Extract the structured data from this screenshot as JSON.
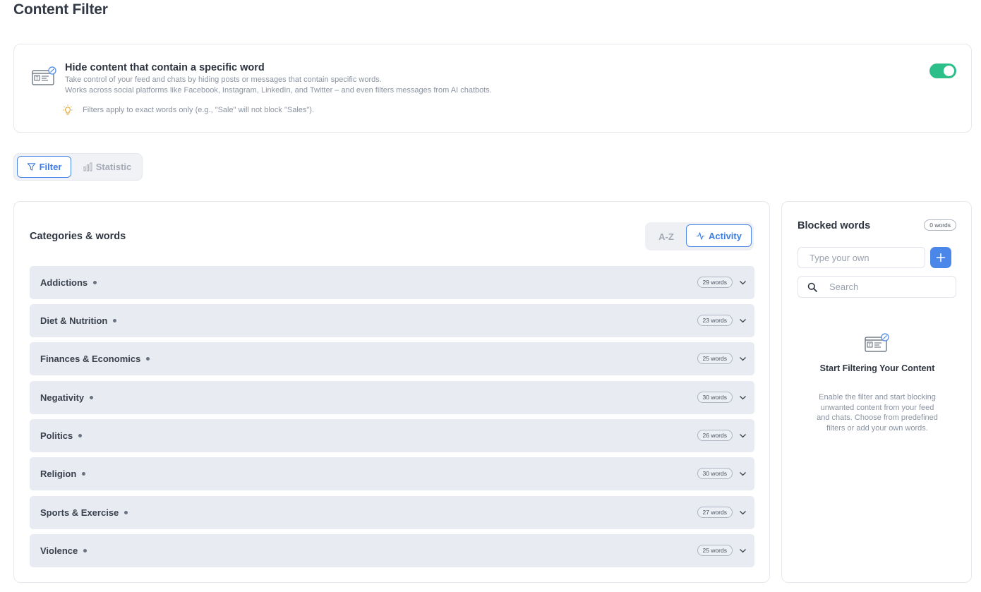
{
  "page": {
    "title": "Content Filter"
  },
  "info": {
    "title": "Hide content that contain a specific word",
    "desc_line1": "Take control of your feed and chats by hiding posts or messages that contain specific words.",
    "desc_line2": "Works across social platforms like Facebook, Instagram, LinkedIn, and Twitter – and even filters messages from AI chatbots.",
    "tip": "Filters apply to exact words only (e.g., \"Sale\" will not block \"Sales\").",
    "toggle_on": true,
    "toggle_color": "#2dbf8a"
  },
  "tabs": {
    "filter": "Filter",
    "statistic": "Statistic",
    "active": "filter"
  },
  "categories": {
    "title": "Categories & words",
    "sort_az": "A-Z",
    "sort_activity": "Activity",
    "active_sort": "activity",
    "items": [
      {
        "name": "Addictions",
        "count": "29 words"
      },
      {
        "name": "Diet & Nutrition",
        "count": "23 words"
      },
      {
        "name": "Finances & Economics",
        "count": "25 words"
      },
      {
        "name": "Negativity",
        "count": "30 words"
      },
      {
        "name": "Politics",
        "count": "26 words"
      },
      {
        "name": "Religion",
        "count": "30 words"
      },
      {
        "name": "Sports & Exercise",
        "count": "27 words"
      },
      {
        "name": "Violence",
        "count": "25 words"
      }
    ]
  },
  "blocked": {
    "title": "Blocked words",
    "count": "0 words",
    "input_placeholder": "Type your own",
    "search_placeholder": "Search",
    "empty_title": "Start Filtering Your Content",
    "empty_desc": "Enable the filter and start blocking unwanted content from your feed and chats. Choose from predefined filters or add your own words."
  },
  "colors": {
    "accent": "#4a87e8",
    "row_bg": "#e8ebf2"
  }
}
